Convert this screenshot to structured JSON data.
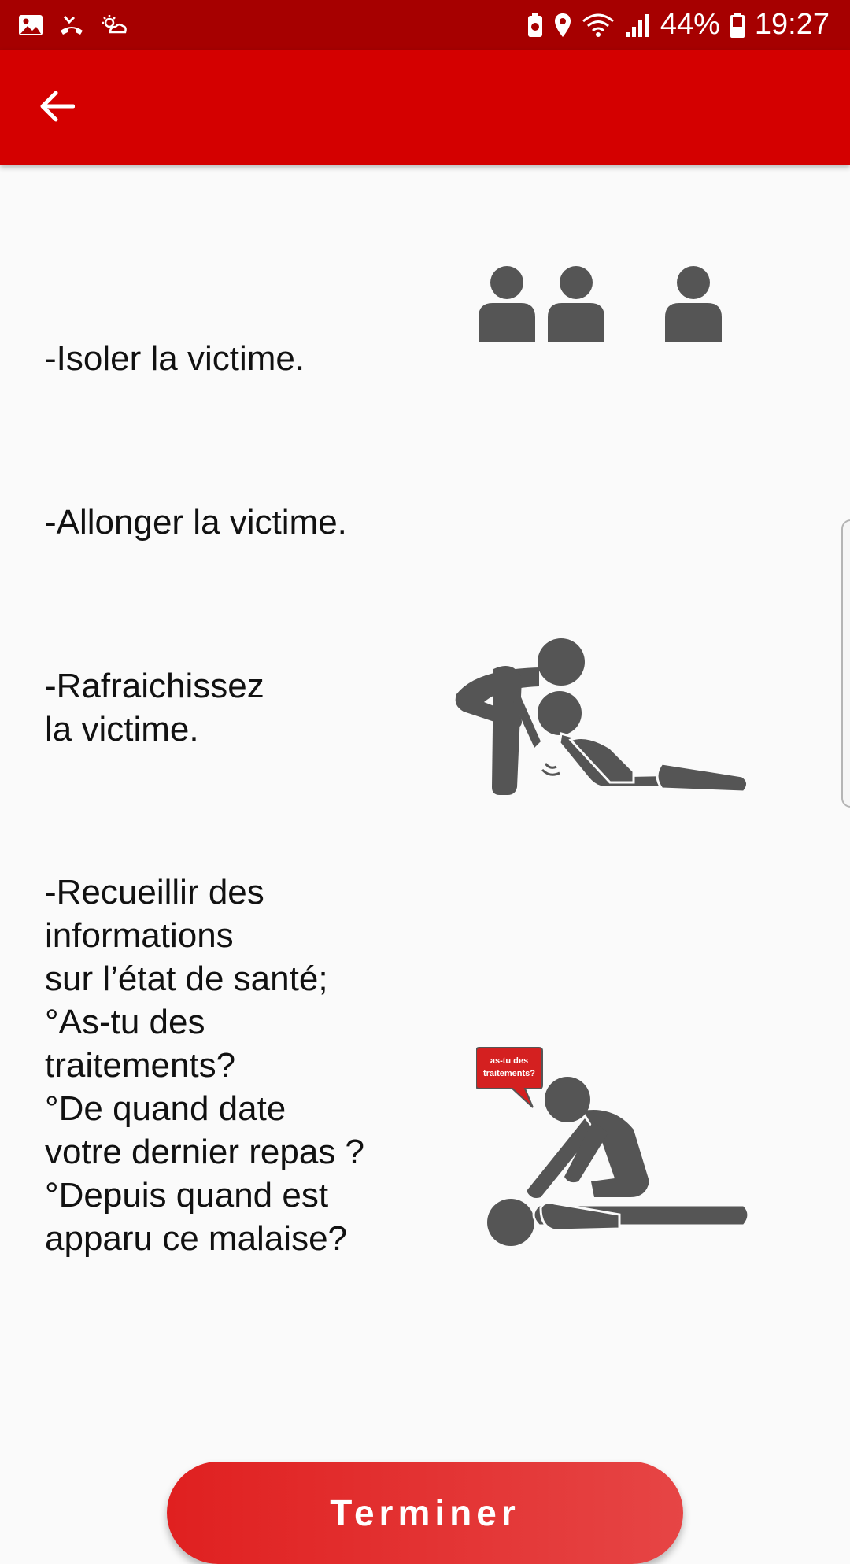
{
  "status_bar": {
    "battery_percent": "44%",
    "time": "19:27",
    "icons": [
      "gallery-icon",
      "missed-call-icon",
      "weather-icon",
      "battery-saver-icon",
      "location-icon",
      "wifi-icon",
      "signal-icon",
      "battery-icon"
    ]
  },
  "app_bar": {
    "back_icon": "arrow-left-icon"
  },
  "steps": [
    {
      "text": "-Isoler la victime.",
      "illustration": "isolated-people-icon"
    },
    {
      "text": "-Allonger la victime.",
      "illustration": ""
    },
    {
      "text": "-Rafraichissez\nla victime.",
      "illustration": "rescuer-cooling-victim-icon"
    },
    {
      "text": "-Recueillir des\ninformations\nsur l’état de santé;\n°As-tu des\ntraitements?\n°De quand date\nvotre dernier repas ?\n°Depuis quand est\napparu ce malaise?",
      "illustration": "rescuer-asking-victim-icon",
      "bubble_text": "as-tu des\ntraitements?"
    }
  ],
  "finish_button": {
    "label": "Terminer"
  },
  "colors": {
    "status_bar": "#a60000",
    "app_bar": "#d40000",
    "accent": "#e02020",
    "icon_gray": "#555555"
  }
}
